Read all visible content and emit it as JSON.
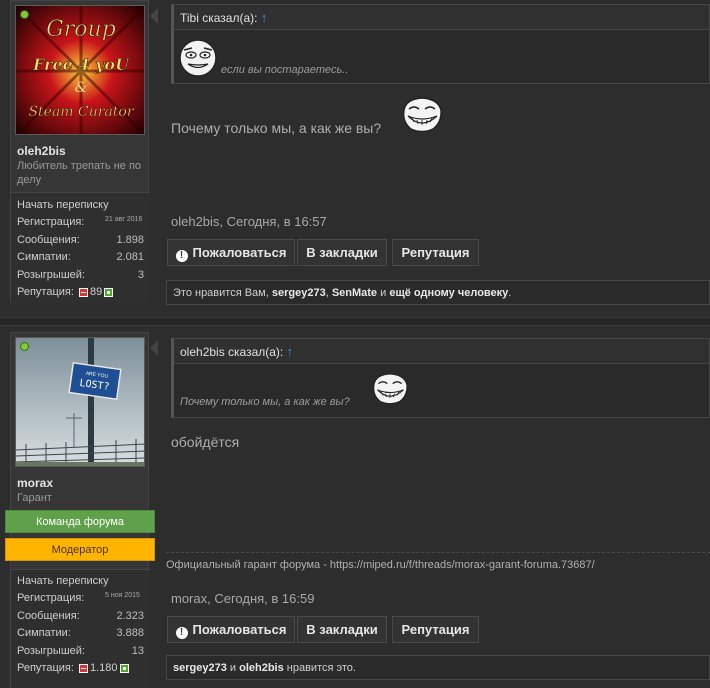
{
  "posts": [
    {
      "username": "oleh2bis",
      "user_title": "Любитель трепать не по делу",
      "start_conversation": "Начать переписку",
      "stats": {
        "registration_label": "Регистрация:",
        "registration_value": "21 авг 2016",
        "messages_label": "Сообщения:",
        "messages_value": "1.898",
        "likes_label": "Симпатии:",
        "likes_value": "2.081",
        "giveaways_label": "Розыгрышей:",
        "giveaways_value": "3",
        "reputation_label": "Репутация:",
        "reputation_value": "89"
      },
      "avatar_text": [
        "Group",
        "Free 4 yoU",
        "&",
        "Steam Curator"
      ],
      "quote_author": "Tibi сказал(а):",
      "quote_arrow": "↑",
      "quote_text": "если вы постараетесь..",
      "message": "Почему только мы, а как же вы?",
      "meta": "oleh2bis, Сегодня, в 16:57",
      "buttons": {
        "report": "Пожаловаться",
        "bookmark": "В закладки",
        "reputation": "Репутация"
      },
      "likes_prefix": "Это нравится Вам, ",
      "likes_user1": "sergey273",
      "likes_sep1": ", ",
      "likes_user2": "SenMate",
      "likes_and": " и ",
      "likes_more": "ещё одному человеку",
      "likes_suffix": "."
    },
    {
      "username": "morax",
      "user_title": "Гарант",
      "banner1": "Команда форума",
      "banner2": "Модератор",
      "start_conversation": "Начать переписку",
      "stats": {
        "registration_label": "Регистрация:",
        "registration_value": "5 ноя 2015",
        "messages_label": "Сообщения:",
        "messages_value": "2.323",
        "likes_label": "Симпатии:",
        "likes_value": "3.888",
        "giveaways_label": "Розыгрышей:",
        "giveaways_value": "13",
        "reputation_label": "Репутация:",
        "reputation_value": "1.180"
      },
      "avatar_sign_small": "ARE YOU",
      "avatar_sign": "LOST?",
      "quote_author": "oleh2bis сказал(а):",
      "quote_arrow": "↑",
      "quote_text": "Почему только мы, а как же вы?",
      "message": "обойдётся",
      "signature": "Официальный гарант форума - https://miped.ru/f/threads/morax-garant-foruma.73687/",
      "meta": "morax, Сегодня, в 16:59",
      "buttons": {
        "report": "Пожаловаться",
        "bookmark": "В закладки",
        "reputation": "Репутация"
      },
      "likes_user1": "sergey273",
      "likes_and": " и ",
      "likes_user2": "oleh2bis",
      "likes_suffix": " нравится это."
    }
  ]
}
